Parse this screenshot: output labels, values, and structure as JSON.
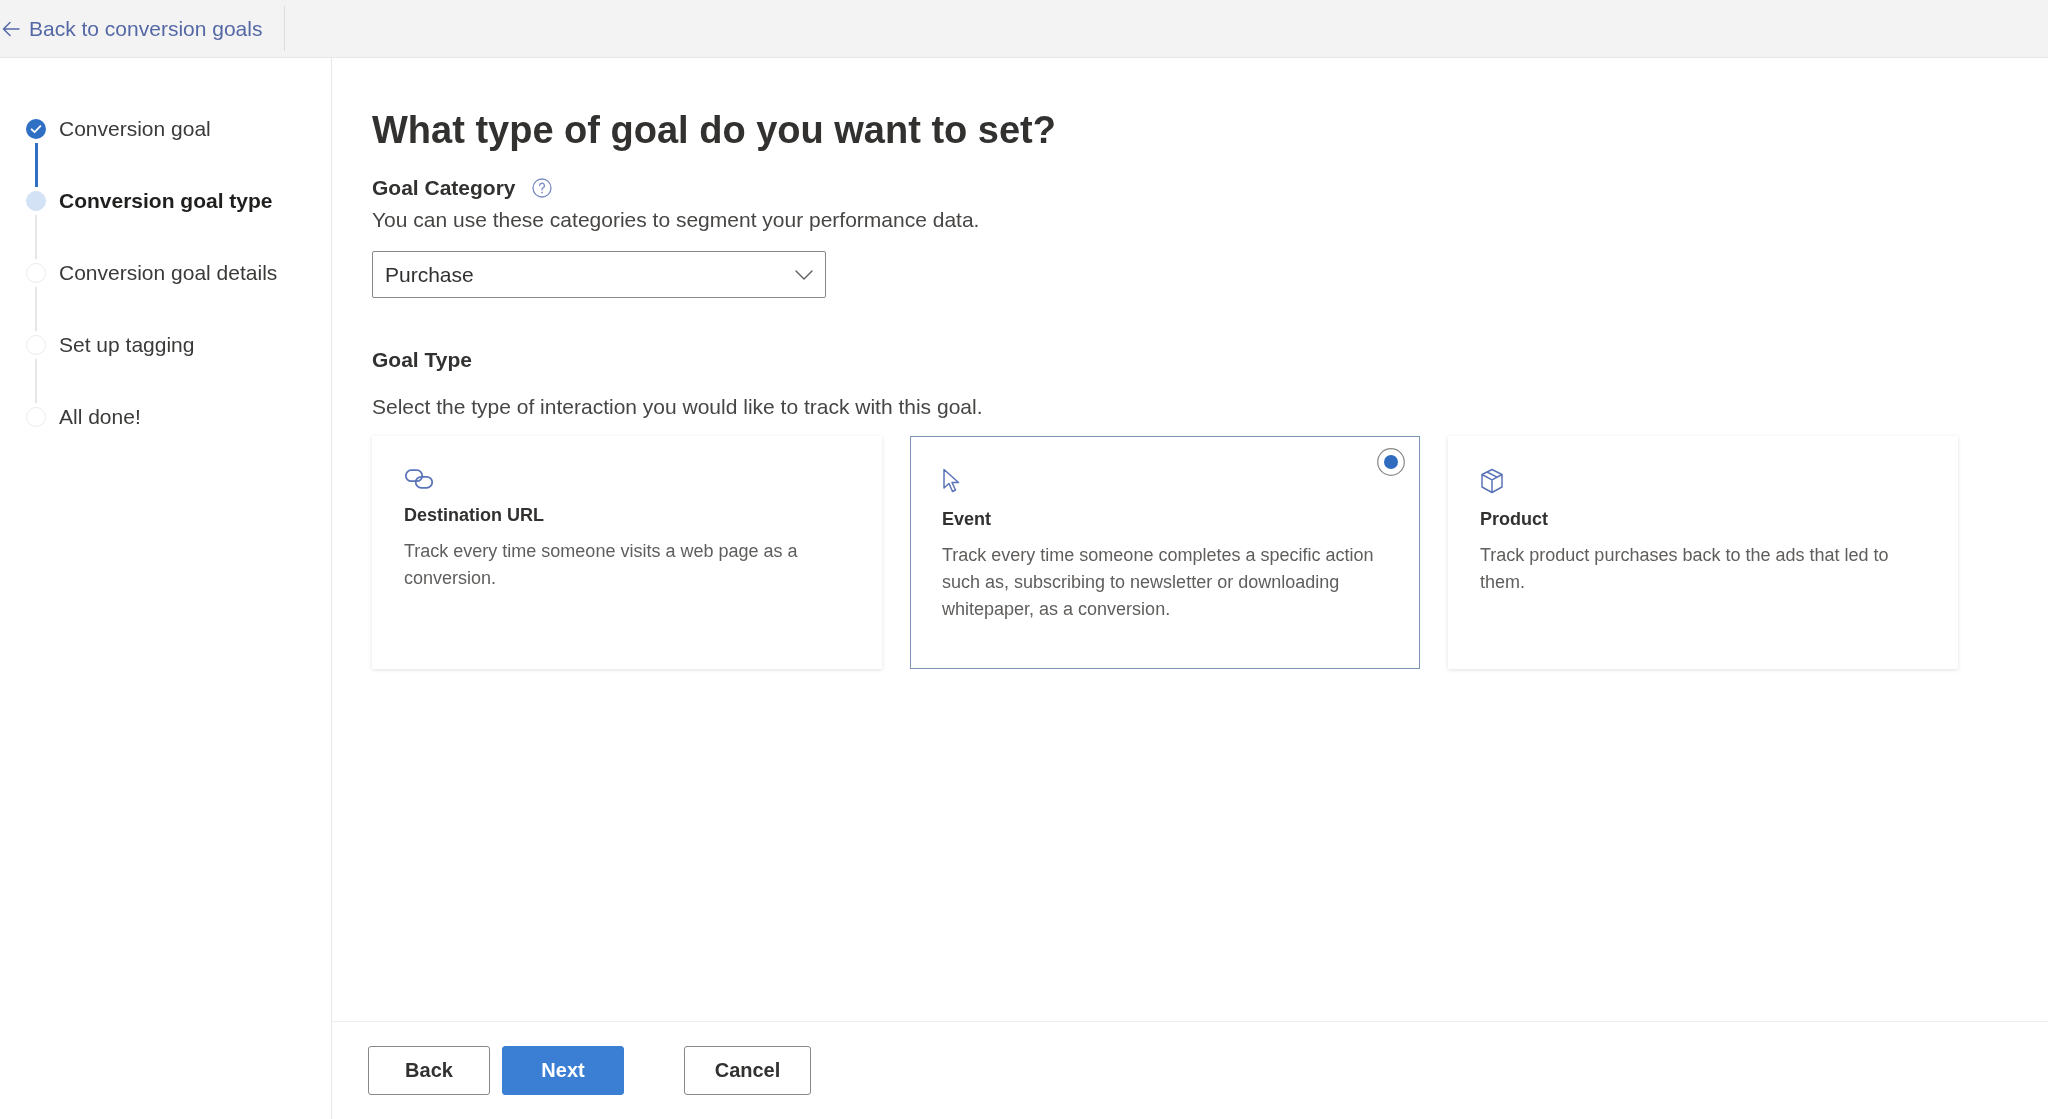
{
  "header": {
    "back_link": "Back to conversion goals"
  },
  "steps": [
    {
      "label": "Conversion goal",
      "done": true,
      "current": false
    },
    {
      "label": "Conversion goal type",
      "done": false,
      "current": true
    },
    {
      "label": "Conversion goal details",
      "done": false,
      "current": false
    },
    {
      "label": "Set up tagging",
      "done": false,
      "current": false
    },
    {
      "label": "All done!",
      "done": false,
      "current": false
    }
  ],
  "page_title": "What type of goal do you want to set?",
  "goal_category": {
    "label": "Goal Category",
    "description": "You can use these categories to segment your performance data.",
    "dropdown": {
      "value": "Purchase"
    }
  },
  "goal_type": {
    "label": "Goal Type",
    "description": "Select the type of interaction you would like to track with this goal.",
    "options": [
      {
        "kind": "url",
        "title": "Destination URL",
        "description": "Track every time someone visits a web page as a conversion.",
        "selected": false
      },
      {
        "kind": "event",
        "title": "Event",
        "description": "Track every time someone completes a specific action such as, subscribing to newsletter or downloading whitepaper, as a conversion.",
        "selected": true
      },
      {
        "kind": "product",
        "title": "Product",
        "description": "Track product purchases back to the ads that led to them.",
        "selected": false
      }
    ]
  },
  "footer": {
    "nav_buttons": [
      {
        "label": "Back",
        "kind": "secondary"
      },
      {
        "label": "Next",
        "kind": "primary"
      }
    ],
    "cancel_button": "Cancel"
  }
}
